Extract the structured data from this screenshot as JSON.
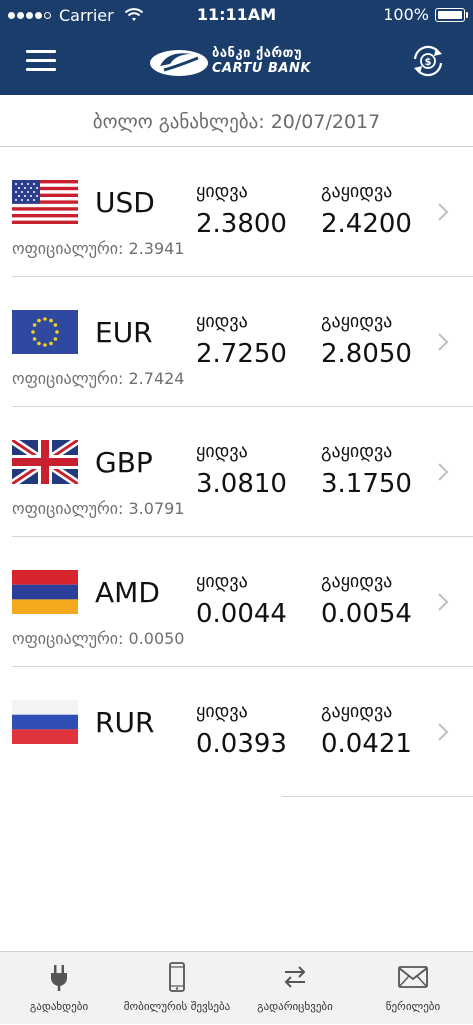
{
  "status": {
    "carrier": "Carrier",
    "time": "11:11AM",
    "battery": "100%",
    "signal_bars": 4
  },
  "header": {
    "logo_line1": "ბანკი ქართუ",
    "logo_line2": "CARTU BANK",
    "menu_icon": "hamburger-menu-icon",
    "exchange_icon": "currency-exchange-icon",
    "bg_color": "#1a3d6c"
  },
  "last_update": {
    "text": "ბოლო განახლება: 20/07/2017"
  },
  "rates": [
    {
      "code": "USD",
      "flag": "us-flag-icon",
      "buy_label": "ყიდვა",
      "buy": "2.3800",
      "sell_label": "გაყიდვა",
      "sell": "2.4200",
      "official": "ოფიციალური: 2.3941"
    },
    {
      "code": "EUR",
      "flag": "eu-flag-icon",
      "buy_label": "ყიდვა",
      "buy": "2.7250",
      "sell_label": "გაყიდვა",
      "sell": "2.8050",
      "official": "ოფიციალური: 2.7424"
    },
    {
      "code": "GBP",
      "flag": "uk-flag-icon",
      "buy_label": "ყიდვა",
      "buy": "3.0810",
      "sell_label": "გაყიდვა",
      "sell": "3.1750",
      "official": "ოფიციალური: 3.0791"
    },
    {
      "code": "AMD",
      "flag": "armenia-flag-icon",
      "buy_label": "ყიდვა",
      "buy": "0.0044",
      "sell_label": "გაყიდვა",
      "sell": "0.0054",
      "official": "ოფიციალური: 0.0050"
    },
    {
      "code": "RUR",
      "flag": "russia-flag-icon",
      "buy_label": "ყიდვა",
      "buy": "0.0393",
      "sell_label": "გაყიდვა",
      "sell": "0.0421",
      "official": ""
    }
  ],
  "tabs": [
    {
      "label": "გადახდები",
      "icon": "plug-icon"
    },
    {
      "label": "მობილურის შევსება",
      "icon": "mobile-phone-icon"
    },
    {
      "label": "გადარიცხვები",
      "icon": "transfer-arrows-icon"
    },
    {
      "label": "წერილები",
      "icon": "envelope-icon"
    }
  ]
}
